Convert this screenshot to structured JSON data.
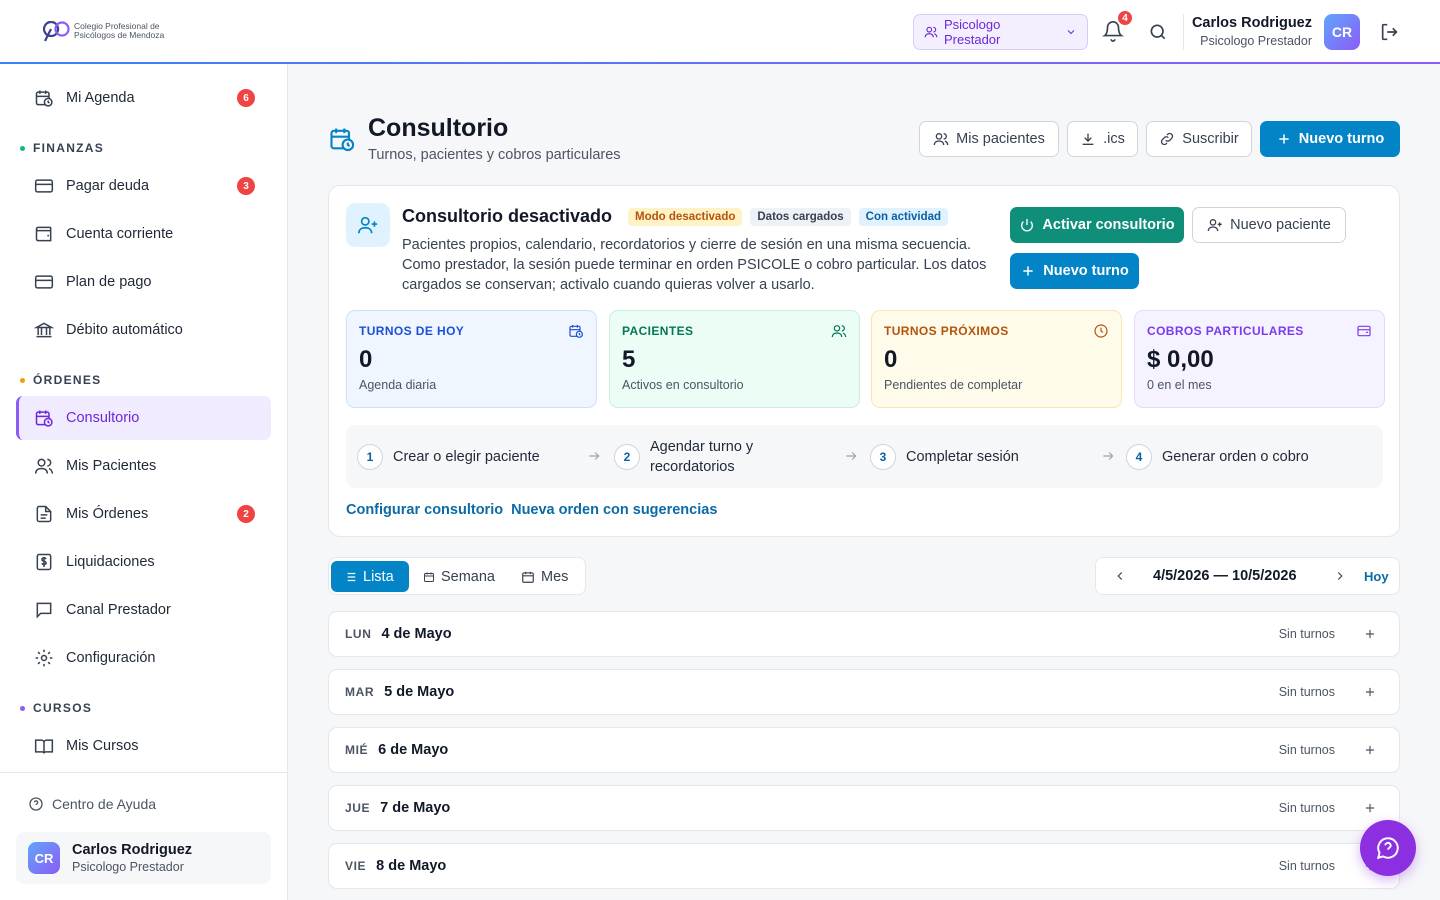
{
  "header": {
    "logo_line1": "Colegio Profesional de",
    "logo_line2": "Psicólogos de Mendoza",
    "role_selector": "Psicologo Prestador",
    "notifications_count": "4",
    "user_name": "Carlos Rodriguez",
    "user_role": "Psicologo Prestador",
    "user_initials": "CR"
  },
  "sidebar": {
    "top_item": {
      "label": "Mi Agenda",
      "badge": "6"
    },
    "sections": [
      {
        "title": "FINANZAS",
        "color": "#10b981",
        "items": [
          {
            "label": "Pagar deuda",
            "badge": "3"
          },
          {
            "label": "Cuenta corriente"
          },
          {
            "label": "Plan de pago"
          },
          {
            "label": "Débito automático"
          }
        ]
      },
      {
        "title": "ÓRDENES",
        "color": "#f59e0b",
        "items": [
          {
            "label": "Consultorio",
            "active": true
          },
          {
            "label": "Mis Pacientes"
          },
          {
            "label": "Mis Órdenes",
            "badge": "2"
          },
          {
            "label": "Liquidaciones"
          },
          {
            "label": "Canal Prestador"
          },
          {
            "label": "Configuración"
          }
        ]
      },
      {
        "title": "CURSOS",
        "color": "#8b5cf6",
        "items": [
          {
            "label": "Mis Cursos"
          }
        ]
      }
    ],
    "help": "Centro de Ayuda",
    "user_name": "Carlos Rodriguez",
    "user_role": "Psicologo Prestador",
    "user_initials": "CR"
  },
  "page": {
    "title": "Consultorio",
    "subtitle": "Turnos, pacientes y cobros particulares",
    "actions": {
      "patients": "Mis pacientes",
      "ics": ".ics",
      "subscribe": "Suscribir",
      "new_appointment": "Nuevo turno"
    }
  },
  "card": {
    "title": "Consultorio desactivado",
    "tags": [
      "Modo desactivado",
      "Datos cargados",
      "Con actividad"
    ],
    "description": "Pacientes propios, calendario, recordatorios y cierre de sesión en una misma secuencia. Como prestador, la sesión puede terminar en orden PSICOLE o cobro particular. Los datos cargados se conservan; activalo cuando quieras volver a usarlo.",
    "activate": "Activar consultorio",
    "new_patient": "Nuevo paciente",
    "new_appointment": "Nuevo turno",
    "stats": [
      {
        "label": "TURNOS DE HOY",
        "value": "0",
        "sub": "Agenda diaria",
        "color": "#1d4ed8"
      },
      {
        "label": "PACIENTES",
        "value": "5",
        "sub": "Activos en consultorio",
        "color": "#047857"
      },
      {
        "label": "TURNOS PRÓXIMOS",
        "value": "0",
        "sub": "Pendientes de completar",
        "color": "#b45309"
      },
      {
        "label": "COBROS PARTICULARES",
        "value": "$ 0,00",
        "sub": "0 en el mes",
        "color": "#7c3aed"
      }
    ],
    "steps": [
      {
        "num": "1",
        "label": "Crear o elegir paciente"
      },
      {
        "num": "2",
        "label": "Agendar turno y recordatorios"
      },
      {
        "num": "3",
        "label": "Completar sesión"
      },
      {
        "num": "4",
        "label": "Generar orden o cobro"
      }
    ],
    "links": [
      "Configurar consultorio",
      "Nueva orden con sugerencias"
    ]
  },
  "calendar": {
    "views": [
      "Lista",
      "Semana",
      "Mes"
    ],
    "active_view": "Lista",
    "range": "4/5/2026 — 10/5/2026",
    "today": "Hoy",
    "days": [
      {
        "dow": "LUN",
        "date": "4 de Mayo",
        "status": "Sin turnos"
      },
      {
        "dow": "MAR",
        "date": "5 de Mayo",
        "status": "Sin turnos"
      },
      {
        "dow": "MIÉ",
        "date": "6 de Mayo",
        "status": "Sin turnos"
      },
      {
        "dow": "JUE",
        "date": "7 de Mayo",
        "status": "Sin turnos"
      },
      {
        "dow": "VIE",
        "date": "8 de Mayo",
        "status": "Sin turnos"
      }
    ]
  }
}
